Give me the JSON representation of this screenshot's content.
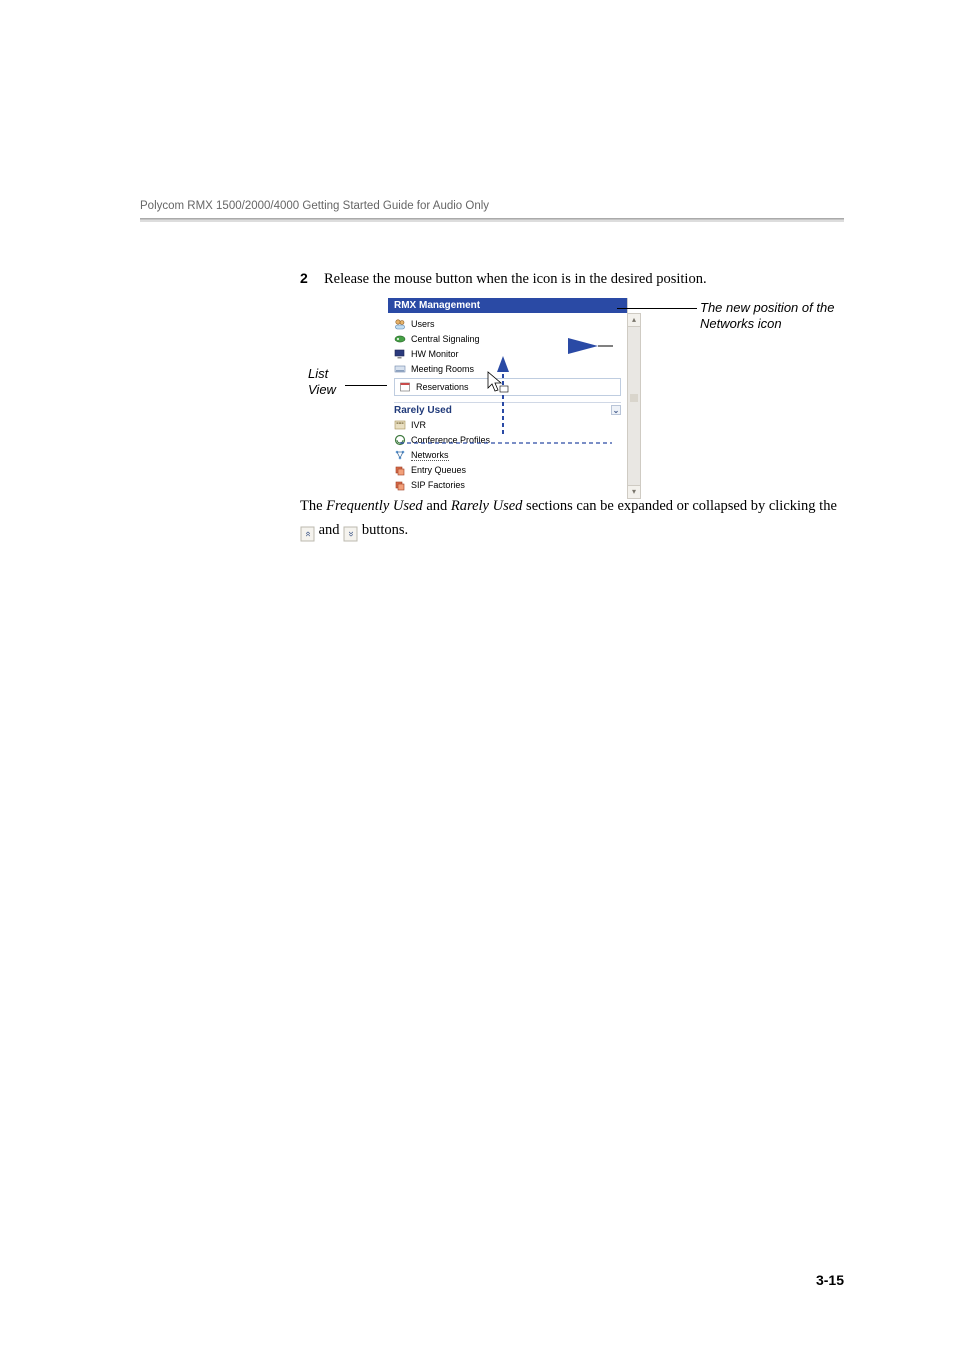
{
  "header": {
    "title": "Polycom RMX 1500/2000/4000 Getting Started Guide for Audio Only"
  },
  "step": {
    "num": "2",
    "text": "Release the mouse button when the icon is in the desired position."
  },
  "captions": {
    "list_view_l1": "List",
    "list_view_l2": "View",
    "new_pos_l1": "The new position of the",
    "new_pos_l2": "Networks icon"
  },
  "panel": {
    "title": "RMX Management",
    "items_top": [
      {
        "label": "Users",
        "icon": "users-icon"
      },
      {
        "label": "Central Signaling",
        "icon": "signaling-icon"
      },
      {
        "label": "HW Monitor",
        "icon": "monitor-icon"
      },
      {
        "label": "Meeting Rooms",
        "icon": "rooms-icon"
      },
      {
        "label": "Reservations",
        "icon": "reservations-icon"
      }
    ],
    "section": "Rarely Used",
    "items_bottom": [
      {
        "label": "IVR",
        "icon": "ivr-icon"
      },
      {
        "label": "Conference Profiles",
        "icon": "profiles-icon"
      },
      {
        "label": "Networks",
        "icon": "networks-icon"
      },
      {
        "label": "Entry Queues",
        "icon": "queues-icon"
      },
      {
        "label": "SIP Factories",
        "icon": "sip-icon"
      }
    ]
  },
  "para": {
    "t1": "The ",
    "em1": "Frequently Used",
    "t2": " and ",
    "em2": "Rarely Used",
    "t3": " sections can be expanded or collapsed by clicking the ",
    "t4": " and ",
    "t5": " buttons."
  },
  "glyphs": {
    "collapse": "«",
    "expand": "»",
    "up": "⌃",
    "down": "⌄"
  },
  "pagenum": "3-15"
}
